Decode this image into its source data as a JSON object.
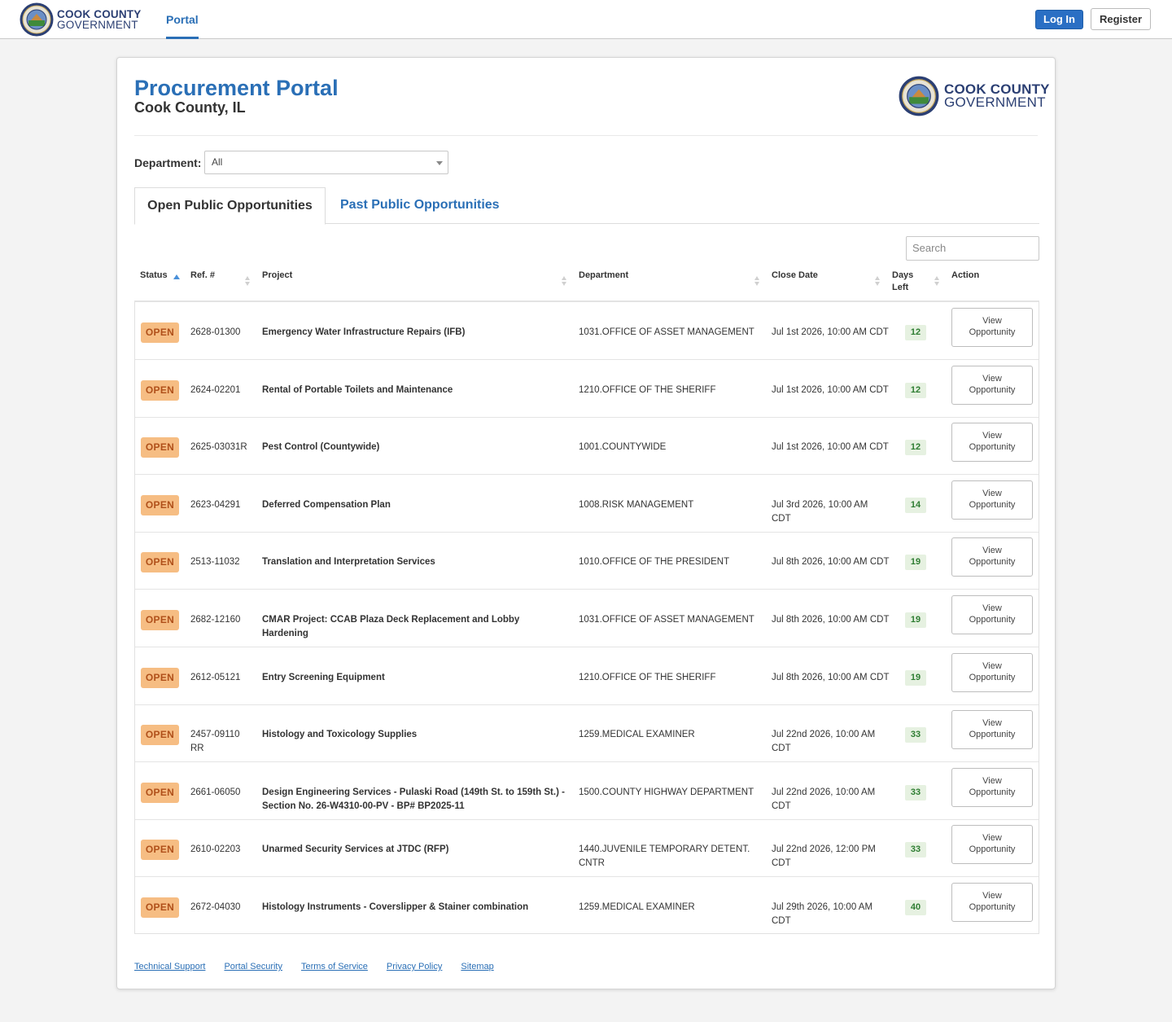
{
  "topbar": {
    "brand_line1": "COOK COUNTY",
    "brand_line2": "GOVERNMENT",
    "nav_portal": "Portal",
    "login": "Log In",
    "register": "Register"
  },
  "header": {
    "title": "Procurement Portal",
    "subtitle": "Cook County, IL",
    "logo_line1": "COOK COUNTY",
    "logo_line2": "GOVERNMENT"
  },
  "filter": {
    "label": "Department:",
    "value": "All"
  },
  "tabs": {
    "open": "Open Public Opportunities",
    "past": "Past Public Opportunities"
  },
  "search": {
    "placeholder": "Search"
  },
  "columns": {
    "status": "Status",
    "ref": "Ref. #",
    "project": "Project",
    "department": "Department",
    "close_date": "Close Date",
    "days_left_1": "Days",
    "days_left_2": "Left",
    "action": "Action"
  },
  "rows": [
    {
      "status": "OPEN",
      "ref": "2628-01300",
      "project": "Emergency Water Infrastructure Repairs (IFB)",
      "department": "1031.OFFICE OF ASSET MANAGEMENT",
      "close": "Jul 1st 2026, 10:00 AM CDT",
      "days": "12",
      "action": "View Opportunity"
    },
    {
      "status": "OPEN",
      "ref": "2624-02201",
      "project": "Rental of Portable Toilets and Maintenance",
      "department": "1210.OFFICE OF THE SHERIFF",
      "close": "Jul 1st 2026, 10:00 AM CDT",
      "days": "12",
      "action": "View Opportunity"
    },
    {
      "status": "OPEN",
      "ref": "2625-03031R",
      "project": "Pest Control (Countywide)",
      "department": "1001.COUNTYWIDE",
      "close": "Jul 1st 2026, 10:00 AM CDT",
      "days": "12",
      "action": "View Opportunity"
    },
    {
      "status": "OPEN",
      "ref": "2623-04291",
      "project": "Deferred Compensation Plan",
      "department": "1008.RISK MANAGEMENT",
      "close": "Jul 3rd 2026, 10:00 AM CDT",
      "days": "14",
      "action": "View Opportunity"
    },
    {
      "status": "OPEN",
      "ref": "2513-11032",
      "project": "Translation and Interpretation Services",
      "department": "1010.OFFICE OF THE PRESIDENT",
      "close": "Jul 8th 2026, 10:00 AM CDT",
      "days": "19",
      "action": "View Opportunity"
    },
    {
      "status": "OPEN",
      "ref": "2682-12160",
      "project": "CMAR Project: CCAB Plaza Deck Replacement and Lobby Hardening",
      "department": "1031.OFFICE OF ASSET MANAGEMENT",
      "close": "Jul 8th 2026, 10:00 AM CDT",
      "days": "19",
      "action": "View Opportunity"
    },
    {
      "status": "OPEN",
      "ref": "2612-05121",
      "project": "Entry Screening Equipment",
      "department": "1210.OFFICE OF THE SHERIFF",
      "close": "Jul 8th 2026, 10:00 AM CDT",
      "days": "19",
      "action": "View Opportunity"
    },
    {
      "status": "OPEN",
      "ref": "2457-09110 RR",
      "project": "Histology and Toxicology Supplies",
      "department": "1259.MEDICAL EXAMINER",
      "close": "Jul 22nd 2026, 10:00 AM CDT",
      "days": "33",
      "action": "View Opportunity"
    },
    {
      "status": "OPEN",
      "ref": "2661-06050",
      "project": "Design Engineering Services - Pulaski Road (149th St. to 159th St.) - Section No. 26-W4310-00-PV - BP# BP2025-11",
      "department": "1500.COUNTY HIGHWAY DEPARTMENT",
      "close": "Jul 22nd 2026, 10:00 AM CDT",
      "days": "33",
      "action": "View Opportunity"
    },
    {
      "status": "OPEN",
      "ref": "2610-02203",
      "project": "Unarmed Security Services at JTDC (RFP)",
      "department": "1440.JUVENILE TEMPORARY DETENT. CNTR",
      "close": "Jul 22nd 2026, 12:00 PM CDT",
      "days": "33",
      "action": "View Opportunity"
    },
    {
      "status": "OPEN",
      "ref": "2672-04030",
      "project": "Histology Instruments - Coverslipper & Stainer combination",
      "department": "1259.MEDICAL EXAMINER",
      "close": "Jul 29th 2026, 10:00 AM CDT",
      "days": "40",
      "action": "View Opportunity"
    }
  ],
  "footer": {
    "links": [
      "Technical Support",
      "Portal Security",
      "Terms of Service",
      "Privacy Policy",
      "Sitemap"
    ]
  },
  "colors": {
    "accent": "#2a6fb6",
    "badge_open_bg": "#f6bd83",
    "badge_open_text": "#b0501a",
    "days_bg": "#e6f1e1",
    "days_text": "#2e7d32"
  }
}
